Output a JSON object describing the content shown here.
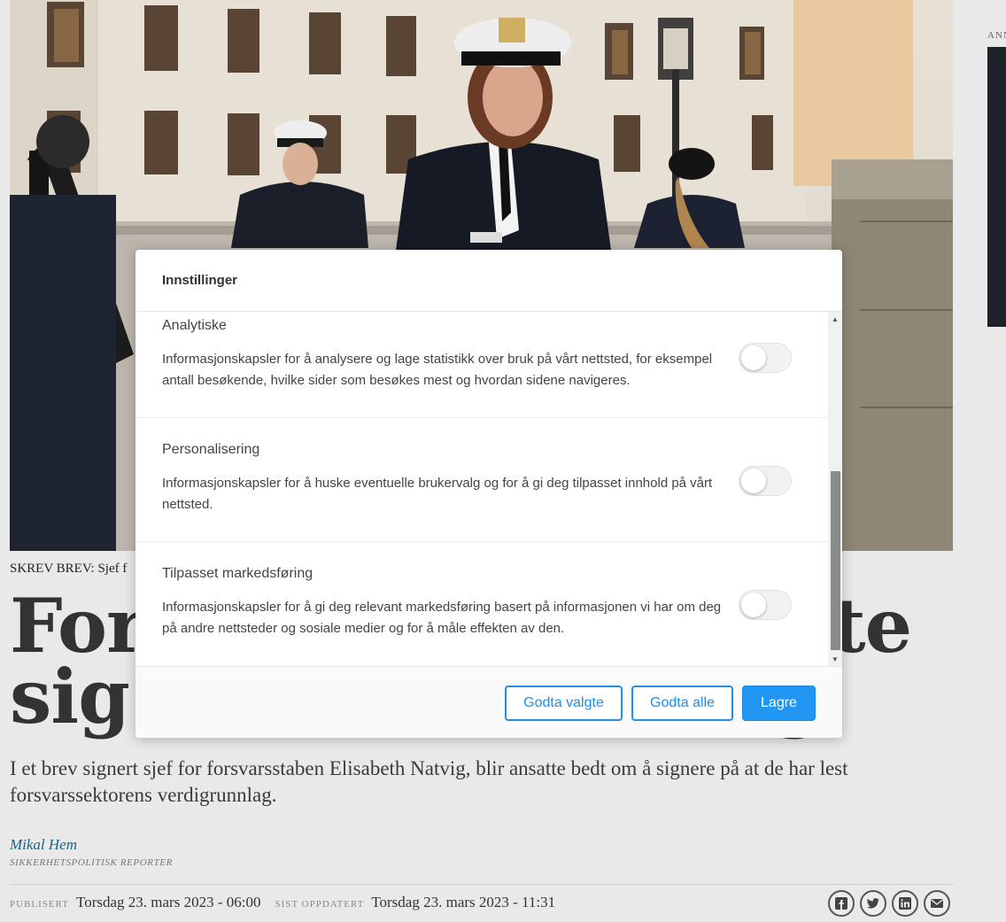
{
  "ad": {
    "label": "ANNONSE"
  },
  "article": {
    "caption": "SKREV BREV: Sjef f",
    "headline_line1": "For",
    "headline_line1_end": "tte",
    "headline_line2": "sig",
    "headline_line2_end": "g",
    "lead": "I et brev signert sjef for forsvarsstaben Elisabeth Natvig, blir ansatte bedt om å signere på at de har lest forsvarssektorens verdigrunnlag.",
    "author": "Mikal Hem",
    "author_role": "SIKKERHETSPOLITISK REPORTER",
    "published_label": "PUBLISERT",
    "published_value": "Torsdag 23. mars 2023 - 06:00",
    "updated_label": "SIST OPPDATERT",
    "updated_value": "Torsdag 23. mars 2023 - 11:31",
    "share_icons": [
      "facebook-icon",
      "twitter-icon",
      "linkedin-icon",
      "email-icon"
    ]
  },
  "dialog": {
    "title": "Innstillinger",
    "sections": [
      {
        "title": "Analytiske",
        "description": "Informasjonskapsler for å analysere og lage statistikk over bruk på vårt nettsted, for eksempel antall besøkende, hvilke sider som besøkes mest og hvordan sidene navigeres.",
        "enabled": false
      },
      {
        "title": "Personalisering",
        "description": "Informasjonskapsler for å huske eventuelle brukervalg og for å gi deg tilpasset innhold på vårt nettsted.",
        "enabled": false
      },
      {
        "title": "Tilpasset markedsføring",
        "description": "Informasjonskapsler for å gi deg relevant markedsføring basert på informasjonen vi har om deg på andre nettsteder og sosiale medier og for å måle effekten av den.",
        "enabled": false
      }
    ],
    "buttons": {
      "accept_selected": "Godta valgte",
      "accept_all": "Godta alle",
      "save": "Lagre"
    }
  }
}
